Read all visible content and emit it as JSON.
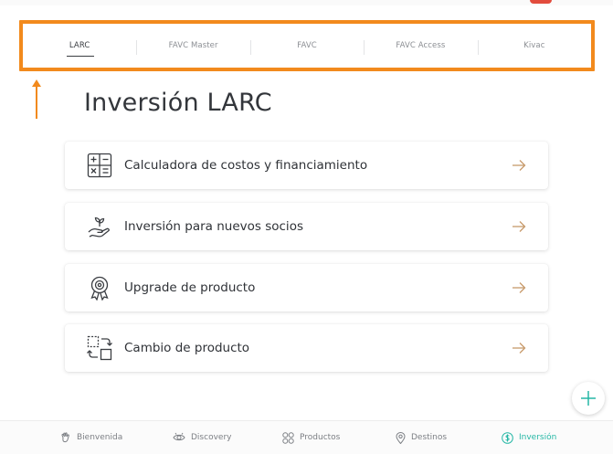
{
  "tabs": [
    {
      "label": "LARC",
      "active": true
    },
    {
      "label": "FAVC Master",
      "active": false
    },
    {
      "label": "FAVC",
      "active": false
    },
    {
      "label": "FAVC Access",
      "active": false
    },
    {
      "label": "Kivac",
      "active": false
    }
  ],
  "page": {
    "title": "Inversión LARC"
  },
  "cards": [
    {
      "label": "Calculadora de costos y financiamiento",
      "icon": "calculator-icon"
    },
    {
      "label": "Inversión para nuevos socios",
      "icon": "hand-plant-icon"
    },
    {
      "label": "Upgrade de producto",
      "icon": "award-medal-icon"
    },
    {
      "label": "Cambio de producto",
      "icon": "swap-boxes-icon"
    }
  ],
  "bottom_nav": [
    {
      "label": "Bienvenida",
      "icon": "wave-hand-icon",
      "active": false
    },
    {
      "label": "Discovery",
      "icon": "eye-icon",
      "active": false
    },
    {
      "label": "Productos",
      "icon": "grid-icon",
      "active": false
    },
    {
      "label": "Destinos",
      "icon": "map-pin-icon",
      "active": false
    },
    {
      "label": "Inversión",
      "icon": "dollar-circle-icon",
      "active": true
    }
  ],
  "colors": {
    "highlight_border": "#f28a1d",
    "accent": "#25b7a5",
    "arrow": "#c79a6b",
    "text": "#2f3237"
  }
}
